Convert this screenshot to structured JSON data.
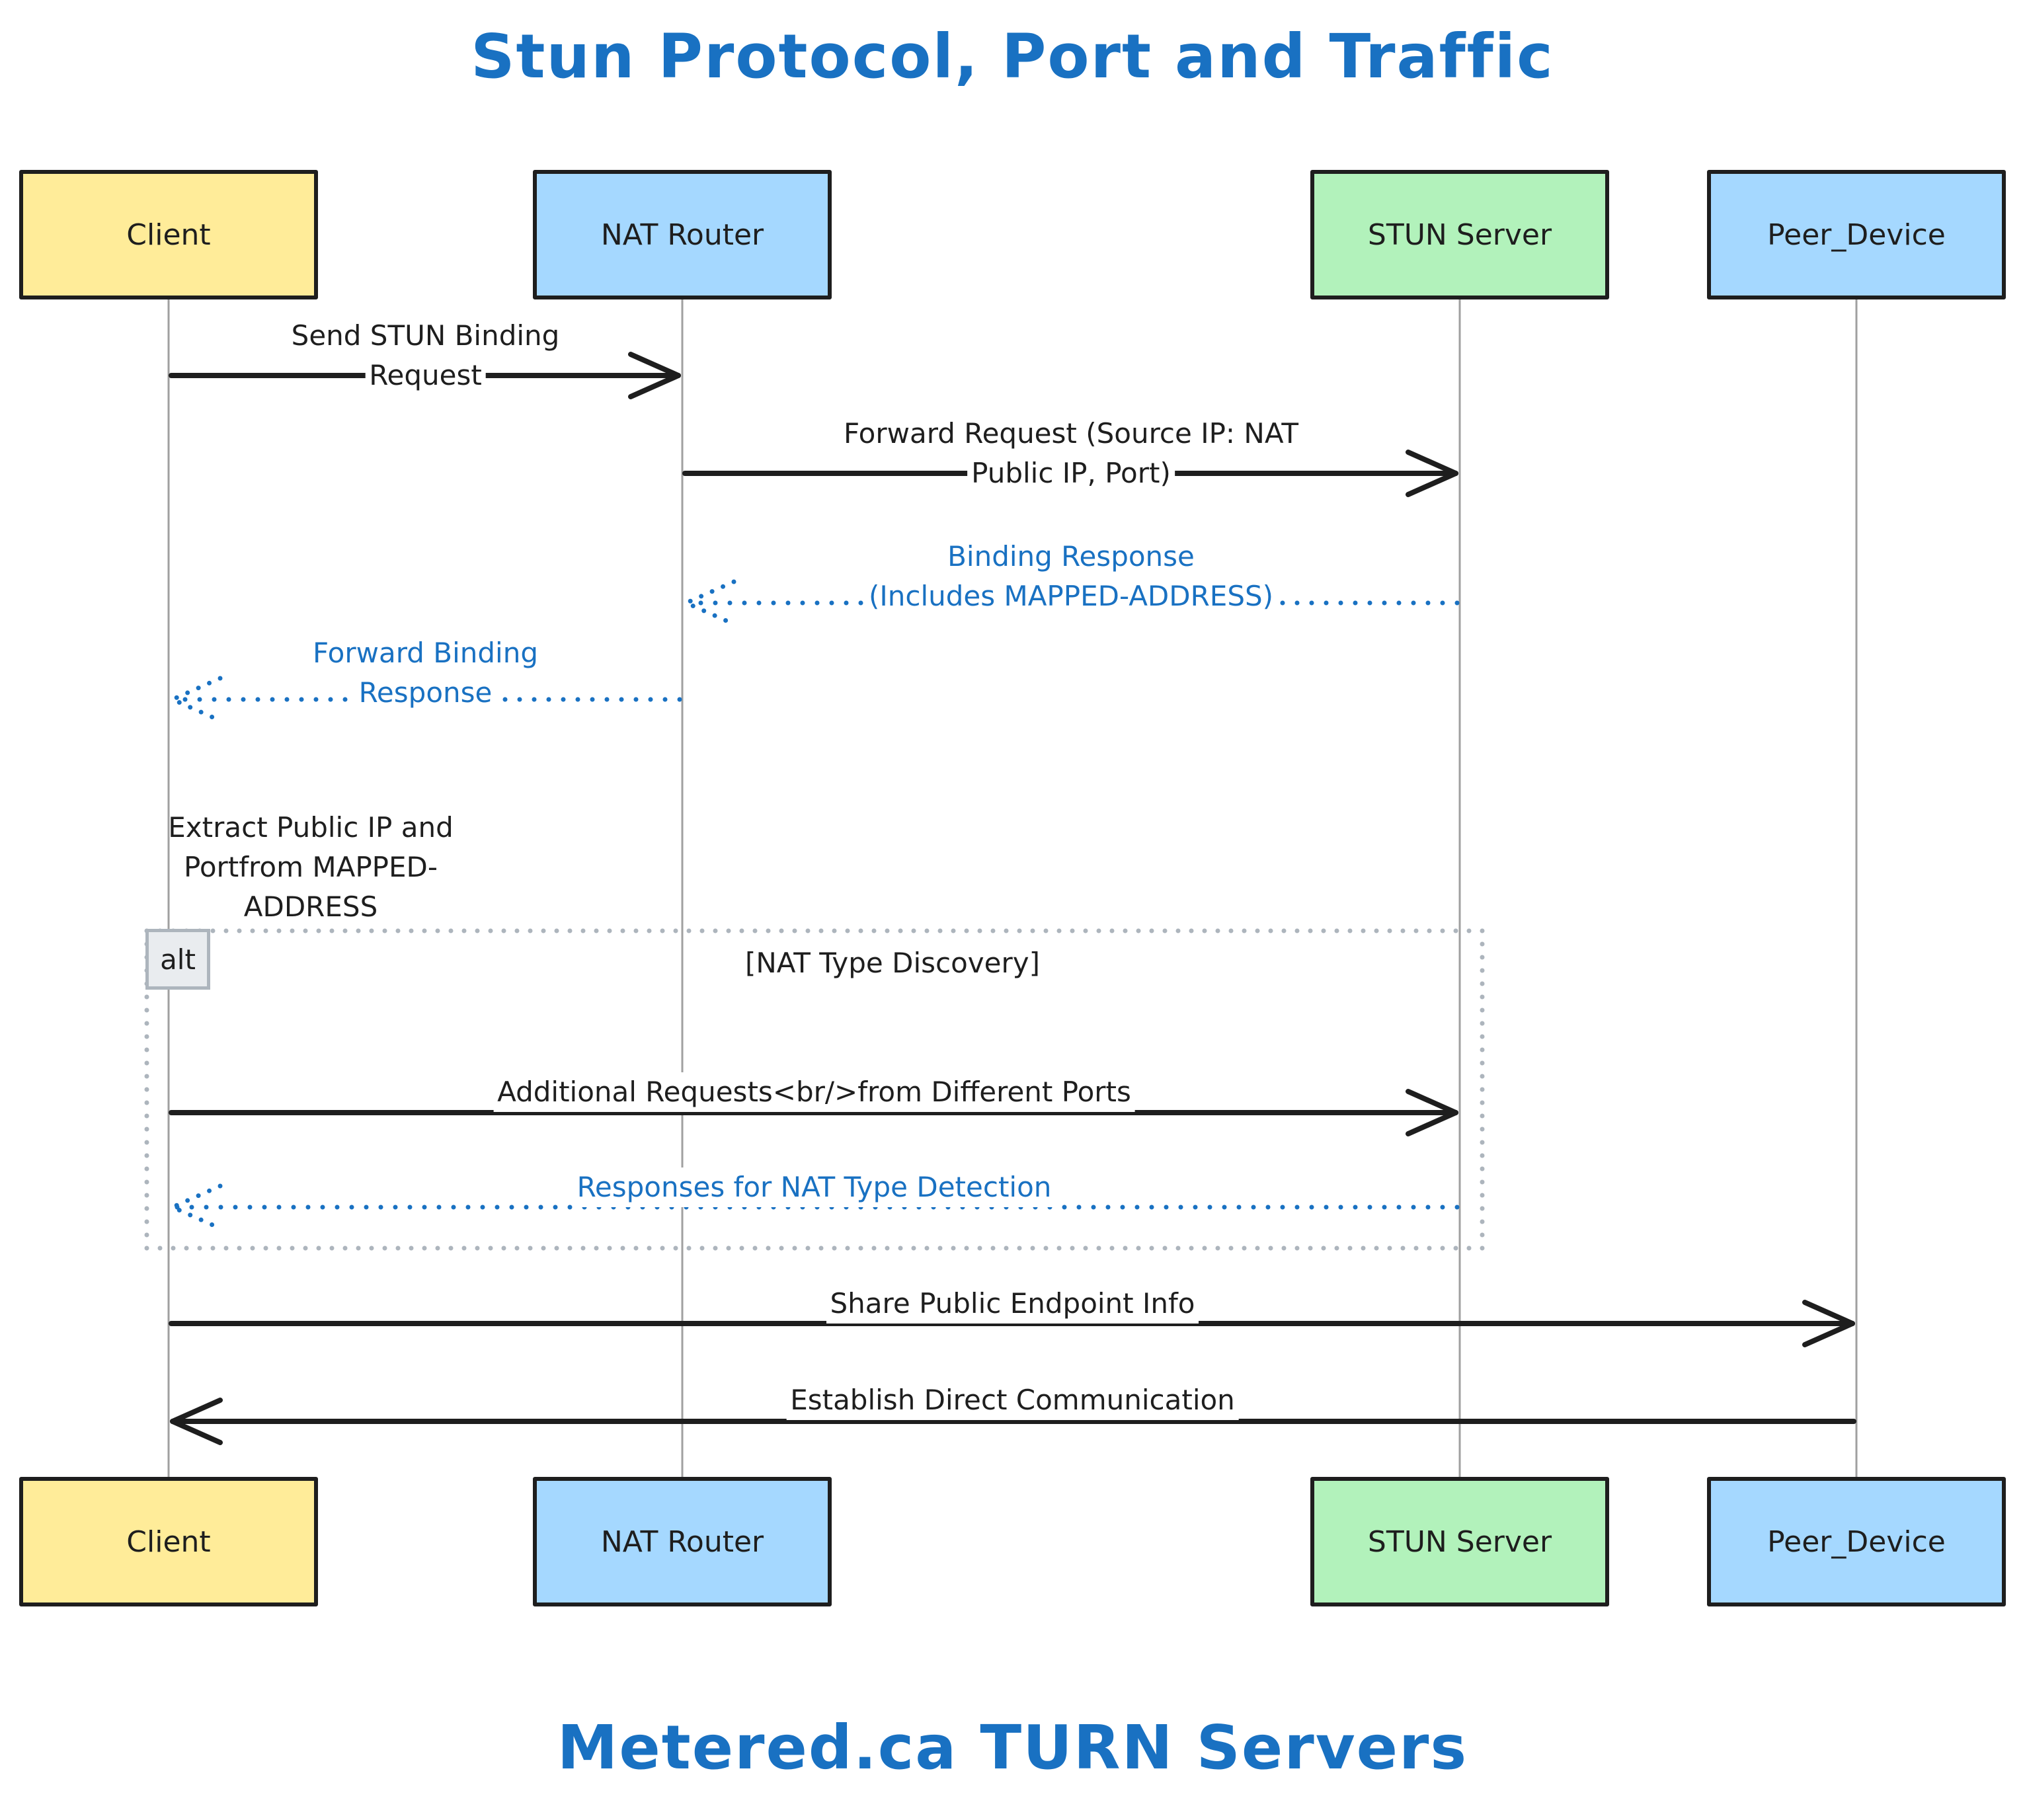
{
  "title": "Stun Protocol, Port and Traffic",
  "footer": "Metered.ca TURN Servers",
  "colors": {
    "title": "#1971c2",
    "stroke": "#1e1e1e",
    "reply": "#1971c2",
    "lifeline": "#a0a0a0",
    "alt_border": "#adb5bd",
    "alt_fill": "#e9ecef"
  },
  "participants": [
    {
      "id": "client",
      "label": "Client",
      "fill": "#ffec99"
    },
    {
      "id": "nat",
      "label": "NAT Router",
      "fill": "#a5d8ff"
    },
    {
      "id": "stun",
      "label": "STUN Server",
      "fill": "#b2f2bb"
    },
    {
      "id": "peer",
      "label": "Peer_Device",
      "fill": "#a5d8ff"
    }
  ],
  "messages": [
    {
      "from": "client",
      "to": "nat",
      "style": "solid",
      "lines": [
        "Send STUN Binding",
        "Request"
      ]
    },
    {
      "from": "nat",
      "to": "stun",
      "style": "solid",
      "lines": [
        "Forward Request (Source IP: NAT",
        "Public IP, Port)"
      ]
    },
    {
      "from": "stun",
      "to": "nat",
      "style": "dotted",
      "lines": [
        "Binding Response",
        "(Includes MAPPED-ADDRESS)"
      ]
    },
    {
      "from": "nat",
      "to": "client",
      "style": "dotted",
      "lines": [
        "Forward Binding",
        "Response"
      ]
    },
    {
      "from": "client",
      "to": "stun",
      "style": "solid",
      "lines": [
        "Additional Requests<br/>from Different Ports"
      ]
    },
    {
      "from": "stun",
      "to": "client",
      "style": "dotted",
      "lines": [
        "Responses for NAT Type Detection"
      ]
    },
    {
      "from": "client",
      "to": "peer",
      "style": "solid",
      "lines": [
        "Share Public Endpoint Info"
      ]
    },
    {
      "from": "peer",
      "to": "client",
      "style": "solid",
      "lines": [
        "Establish Direct Communication"
      ]
    }
  ],
  "note": {
    "over": "client",
    "lines": [
      "Extract Public IP and",
      "Portfrom MAPPED-",
      "ADDRESS"
    ]
  },
  "alt": {
    "tag": "alt",
    "condition": "[NAT Type Discovery]"
  }
}
